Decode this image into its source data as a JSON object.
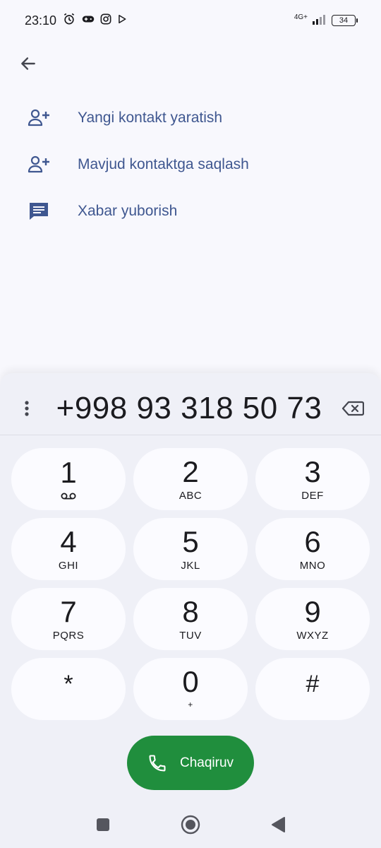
{
  "status_bar": {
    "time": "23:10",
    "network_type": "4G+",
    "battery_level": "34"
  },
  "actions": [
    {
      "label": "Yangi kontakt yaratish",
      "icon": "add-person-icon"
    },
    {
      "label": "Mavjud kontaktga saqlash",
      "icon": "add-person-icon"
    },
    {
      "label": "Xabar yuborish",
      "icon": "message-icon"
    }
  ],
  "dialer": {
    "number": "+998 93 318 50 73",
    "keys": [
      {
        "digit": "1",
        "letters": ""
      },
      {
        "digit": "2",
        "letters": "ABC"
      },
      {
        "digit": "3",
        "letters": "DEF"
      },
      {
        "digit": "4",
        "letters": "GHI"
      },
      {
        "digit": "5",
        "letters": "JKL"
      },
      {
        "digit": "6",
        "letters": "MNO"
      },
      {
        "digit": "7",
        "letters": "PQRS"
      },
      {
        "digit": "8",
        "letters": "TUV"
      },
      {
        "digit": "9",
        "letters": "WXYZ"
      },
      {
        "digit": "*",
        "letters": ""
      },
      {
        "digit": "0",
        "letters": "+"
      },
      {
        "digit": "#",
        "letters": ""
      }
    ],
    "call_label": "Chaqiruv"
  },
  "colors": {
    "accent": "#3f5790",
    "call_button": "#208e3d",
    "background": "#f8f8fd",
    "dialer_background": "#eff0f7"
  }
}
